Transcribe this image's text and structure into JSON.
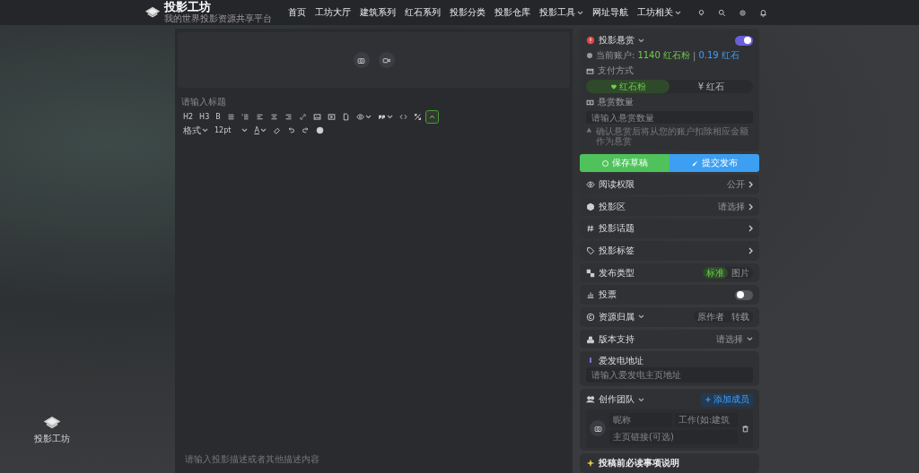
{
  "header": {
    "logo_title": "投影工坊",
    "logo_subtitle": "我的世界投影资源共享平台",
    "nav": [
      {
        "label": "首页",
        "dropdown": false
      },
      {
        "label": "工坊大厅",
        "dropdown": false
      },
      {
        "label": "建筑系列",
        "dropdown": false
      },
      {
        "label": "红石系列",
        "dropdown": false
      },
      {
        "label": "投影分类",
        "dropdown": false
      },
      {
        "label": "投影仓库",
        "dropdown": false
      },
      {
        "label": "投影工具",
        "dropdown": true
      },
      {
        "label": "网址导航",
        "dropdown": false
      },
      {
        "label": "工坊相关",
        "dropdown": true
      }
    ]
  },
  "editor": {
    "title_placeholder": "请输入标题",
    "toolbar_text": [
      "H2",
      "H3",
      "B"
    ],
    "collapse_active": true,
    "format": "格式",
    "font_size": "12pt",
    "font_color": "A",
    "description_placeholder": "请输入投影描述或者其他描述内容"
  },
  "side_logo": {
    "label": "投影工坊"
  },
  "bounty": {
    "title": "投影悬赏",
    "enabled": true,
    "balance_label": "当前账户:",
    "dust": "1140 红石粉",
    "separator": "|",
    "stone": "0.19 红石",
    "payment_label": "支付方式",
    "payment_options": [
      {
        "label": "红石粉",
        "selected": true
      },
      {
        "label": "¥ 红石",
        "selected": false
      }
    ],
    "amount_label": "悬赏数量",
    "amount_placeholder": "请输入悬赏数量",
    "notice": "确认悬赏后将从您的账户扣除相应金额作为悬赏"
  },
  "actions": [
    {
      "label": "保存草稿",
      "kind": "draft"
    },
    {
      "label": "提交发布",
      "kind": "submit"
    }
  ],
  "settings": [
    {
      "kind": "link",
      "label": "阅读权限",
      "value": "公开"
    },
    {
      "kind": "link",
      "label": "投影区",
      "value": "请选择"
    },
    {
      "kind": "link",
      "label": "投影话题"
    },
    {
      "kind": "link",
      "label": "投影标签"
    },
    {
      "kind": "segment",
      "label": "发布类型",
      "dropdown": false,
      "options": [
        {
          "label": "标准",
          "selected": true
        },
        {
          "label": "图片",
          "selected": false
        }
      ]
    },
    {
      "kind": "switch",
      "label": "投票",
      "on": false
    },
    {
      "kind": "segment",
      "label": "资源归属",
      "dropdown": true,
      "options": [
        {
          "label": "原作者",
          "selected": false
        },
        {
          "label": "转载",
          "selected": false
        }
      ]
    },
    {
      "kind": "select",
      "label": "版本支持",
      "value": "请选择"
    },
    {
      "kind": "input",
      "label": "爱发电地址",
      "placeholder": "请输入爱发电主页地址"
    }
  ],
  "team": {
    "title": "创作团队",
    "add_label": "添加成员",
    "name_placeholder": "昵称",
    "role_placeholder": "工作(如:建筑",
    "link_placeholder": "主页链接(可选)"
  },
  "guide": {
    "title": "投稿前必读事项说明"
  }
}
